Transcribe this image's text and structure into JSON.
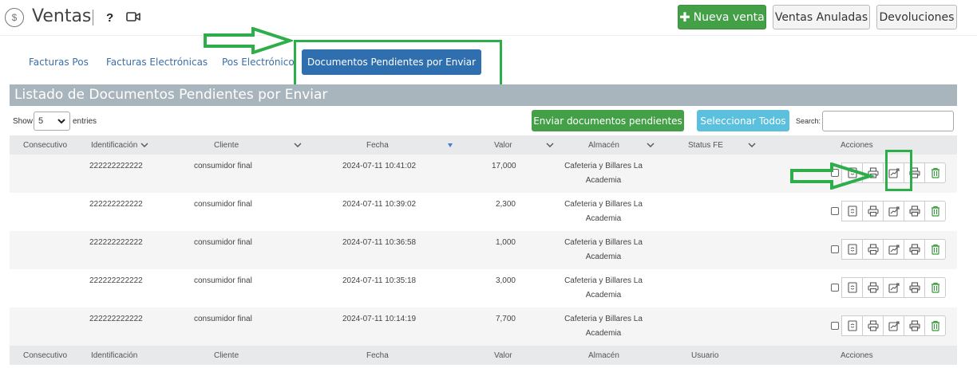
{
  "header": {
    "title": "Ventas",
    "help": "?",
    "buttons": {
      "nueva_venta": "Nueva venta",
      "ventas_anuladas": "Ventas Anuladas",
      "devoluciones": "Devoluciones"
    }
  },
  "tabs": [
    {
      "label": "Facturas Pos"
    },
    {
      "label": "Facturas Electrónicas"
    },
    {
      "label": "Pos Electrónico"
    },
    {
      "label": "Documentos Pendientes por Enviar",
      "active": true
    }
  ],
  "panel": {
    "title": "Listado de Documentos Pendientes por Enviar",
    "show_label": "Show",
    "show_value": "5",
    "entries_label": "entries",
    "send_pending_label": "Enviar documentos pendientes",
    "select_all_label": "Seleccionar Todos",
    "search_label": "Search:",
    "search_value": ""
  },
  "table": {
    "headers": [
      "Consecutivo",
      "Identificación",
      "Cliente",
      "Fecha",
      "Valor",
      "Almacén",
      "Status FE",
      "Acciones"
    ],
    "footer_headers": [
      "Consecutivo",
      "Identificación",
      "Cliente",
      "Fecha",
      "Valor",
      "Almacén",
      "Usuario",
      "Acciones"
    ],
    "rows": [
      {
        "consecutivo": "",
        "identificacion": "222222222222",
        "cliente": "consumidor final",
        "fecha": "2024-07-11 10:41:02",
        "valor": "17,000",
        "almacen1": "Cafeteria y Billares La",
        "almacen2": "Academia",
        "status": ""
      },
      {
        "consecutivo": "",
        "identificacion": "222222222222",
        "cliente": "consumidor final",
        "fecha": "2024-07-11 10:39:02",
        "valor": "2,300",
        "almacen1": "Cafeteria y Billares La",
        "almacen2": "Academia",
        "status": ""
      },
      {
        "consecutivo": "",
        "identificacion": "222222222222",
        "cliente": "consumidor final",
        "fecha": "2024-07-11 10:36:58",
        "valor": "1,000",
        "almacen1": "Cafeteria y Billares La",
        "almacen2": "Academia",
        "status": ""
      },
      {
        "consecutivo": "",
        "identificacion": "222222222222",
        "cliente": "consumidor final",
        "fecha": "2024-07-11 10:35:18",
        "valor": "3,000",
        "almacen1": "Cafeteria y Billares La",
        "almacen2": "Academia",
        "status": ""
      },
      {
        "consecutivo": "",
        "identificacion": "222222222222",
        "cliente": "consumidor final",
        "fecha": "2024-07-11 10:14:19",
        "valor": "7,700",
        "almacen1": "Cafeteria y Billares La",
        "almacen2": "Academia",
        "status": ""
      }
    ],
    "action_icons": [
      "sync-document-icon",
      "print-icon",
      "send-chart-icon",
      "print-alt-icon",
      "trash-icon"
    ]
  },
  "colors": {
    "primary": "#2f6fb0",
    "success": "#43a047",
    "info": "#5bc0de",
    "highlight": "#2eae4a",
    "panel_header": "#a9b5bd"
  }
}
